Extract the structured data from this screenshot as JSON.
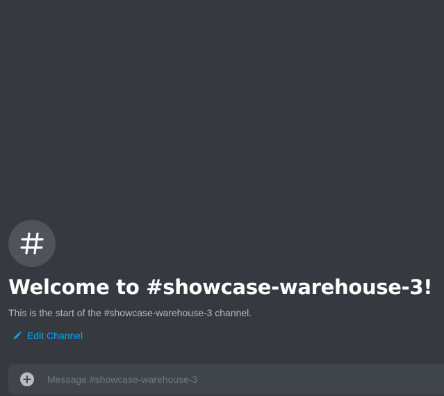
{
  "channel": {
    "icon": "hashtag-icon",
    "welcome_title": "Welcome to #showcase-warehouse-3!",
    "welcome_description": "This is the start of the #showcase-warehouse-3 channel.",
    "edit_label": "Edit Channel",
    "edit_icon": "pencil-icon"
  },
  "composer": {
    "attach_icon": "plus-circle-icon",
    "placeholder": "Message #showcase-warehouse-3"
  },
  "colors": {
    "background": "#36393f",
    "icon_circle": "#4f545c",
    "link": "#00aff4",
    "composer": "#40444b",
    "muted_text": "#b9bbbe",
    "placeholder": "#72767d"
  }
}
